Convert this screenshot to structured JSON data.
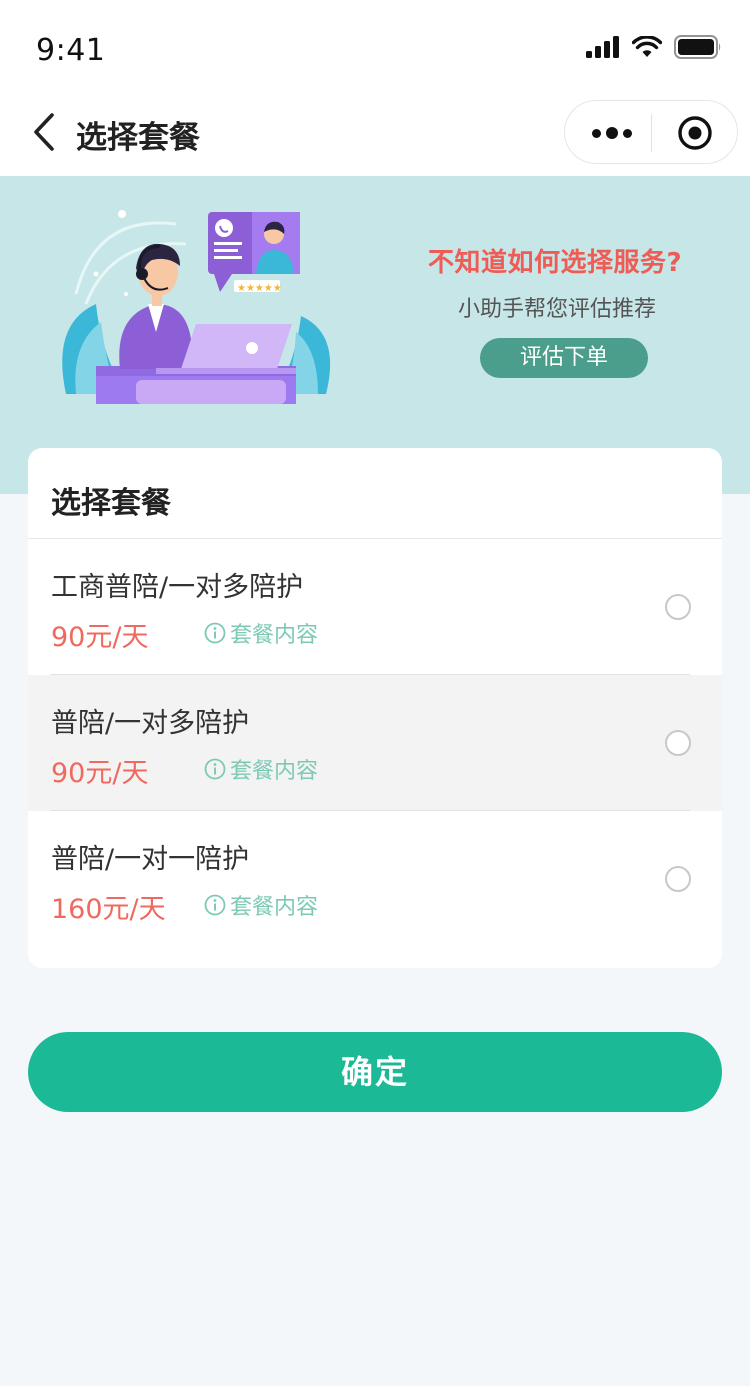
{
  "status_bar": {
    "time": "9:41"
  },
  "nav": {
    "title": "选择套餐"
  },
  "banner": {
    "title": "不知道如何选择服务?",
    "subtitle": "小助手帮您评估推荐",
    "button_label": "评估下单",
    "rating_stars": "★★★★★"
  },
  "card": {
    "title": "选择套餐",
    "packages": [
      {
        "name": "工商普陪/一对多陪护",
        "price": "90元/天",
        "info_label": "套餐内容",
        "selected": false
      },
      {
        "name": "普陪/一对多陪护",
        "price": "90元/天",
        "info_label": "套餐内容",
        "selected": false
      },
      {
        "name": "普陪/一对一陪护",
        "price": "160元/天",
        "info_label": "套餐内容",
        "selected": false
      }
    ]
  },
  "confirm_button_label": "确定",
  "colors": {
    "accent": "#1cb997",
    "price": "#f0695f",
    "info": "#7ec9b5",
    "banner_bg": "#c6e6e7",
    "banner_button": "#4a9e8b"
  }
}
